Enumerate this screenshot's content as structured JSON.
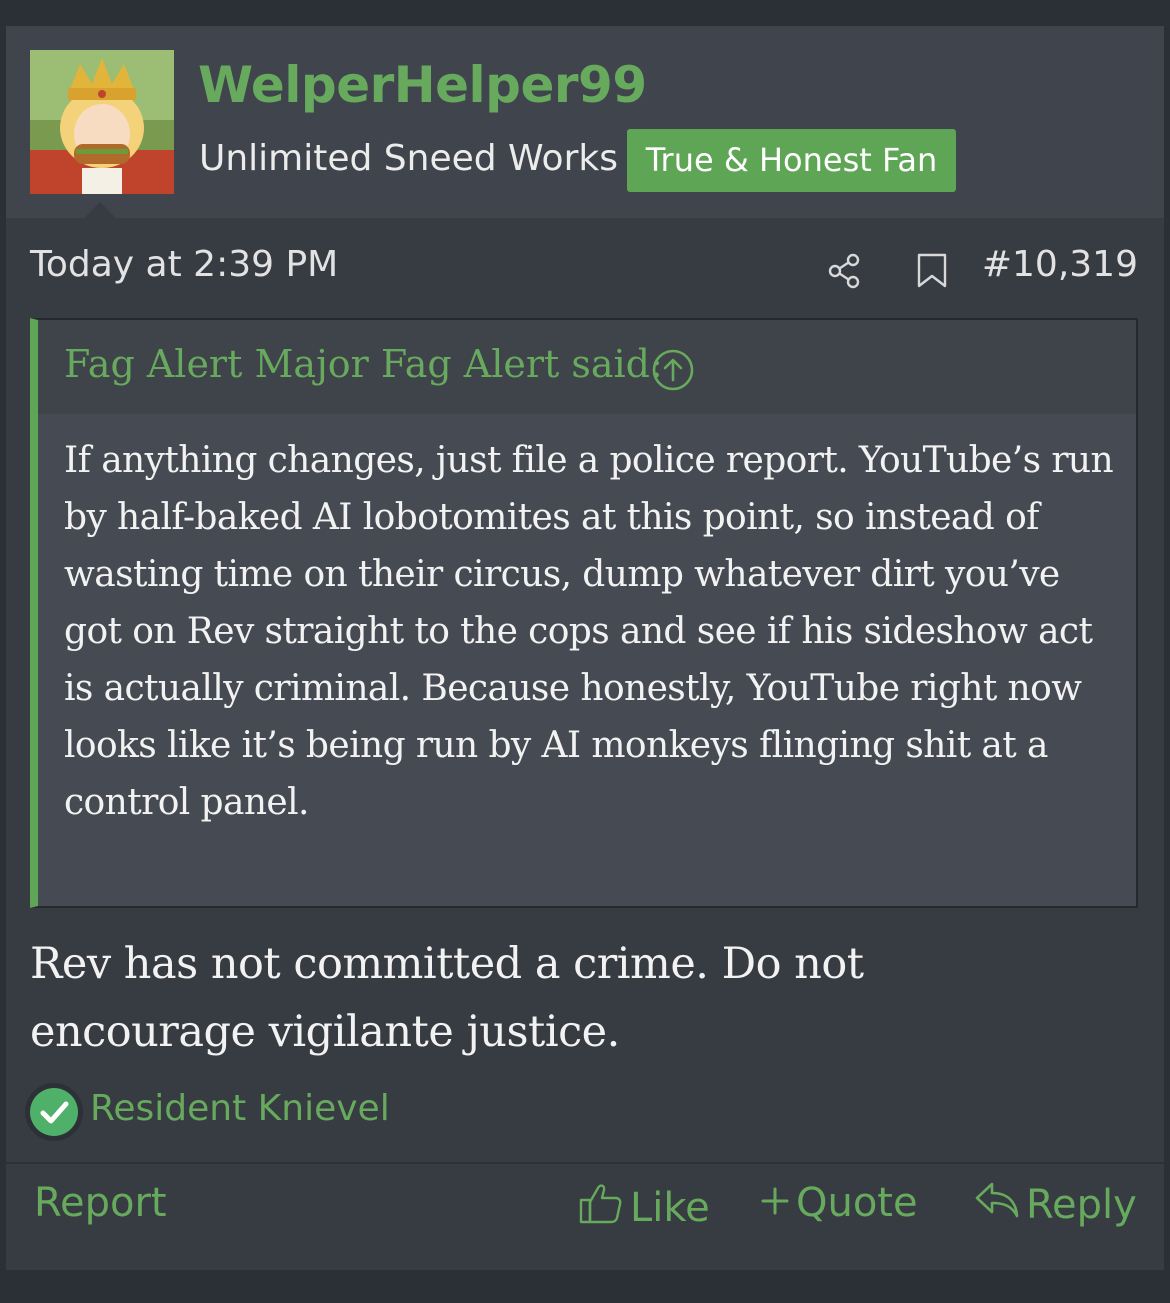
{
  "post": {
    "username": "WelperHelper99",
    "user_title": "Unlimited Sneed Works",
    "user_banner": "True & Honest Fan",
    "date": "Today at 2:39 PM",
    "post_number": "#10,319"
  },
  "quote": {
    "author": "Fag Alert Major Fag Alert said:",
    "text": "If anything changes, just file a police report. YouTube’s run by half-baked AI lobotomites at this point, so instead of wasting time on their circus, dump whatever dirt you’ve got on Rev straight to the cops and see if his sideshow act is actually criminal. Because honestly, YouTube right now looks like it’s being run by AI monkeys flinging shit at a control panel."
  },
  "reply": {
    "text": "Rev has not committed a crime. Do not encourage vigilante justice."
  },
  "reaction": {
    "user": "Resident Knievel",
    "icon": "check-circle-icon"
  },
  "actions": {
    "report": "Report",
    "like": "Like",
    "quote": "Quote",
    "reply": "Reply"
  },
  "colors": {
    "accent": "#67a95d",
    "banner": "#5fa556",
    "background": "#373b42",
    "header": "#40444c"
  }
}
